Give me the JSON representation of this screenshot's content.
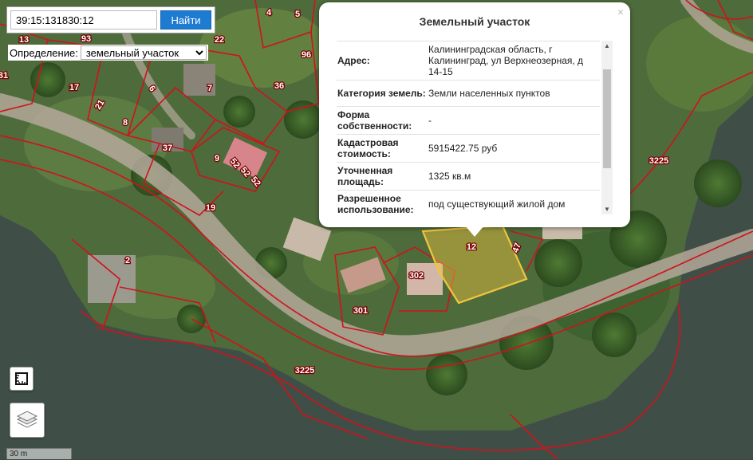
{
  "search": {
    "value": "39:15:131830:12",
    "button_label": "Найти"
  },
  "definition": {
    "label": "Определение:",
    "selected": "земельный участок"
  },
  "popup": {
    "title": "Земельный участок",
    "close_symbol": "×",
    "rows": [
      {
        "key": "Адрес:",
        "value": "Калининградская область, г Калининград, ул Верхнеозерная, д 14-15"
      },
      {
        "key": "Категория земель:",
        "value": "Земли населенных пунктов"
      },
      {
        "key": "Форма собственности:",
        "value": "-"
      },
      {
        "key": "Кадастровая стоимость:",
        "value": "5915422.75 руб"
      },
      {
        "key": "Уточненная площадь:",
        "value": "1325 кв.м"
      },
      {
        "key": "Разрешенное использование:",
        "value": "под существующий жилой дом"
      }
    ]
  },
  "map": {
    "parcel_numbers": [
      "13",
      "93",
      "31",
      "17",
      "21",
      "8",
      "6",
      "7",
      "4",
      "5",
      "22",
      "96",
      "36",
      "37",
      "9",
      "52",
      "52",
      "52",
      "19",
      "2",
      "302",
      "301",
      "12",
      "47",
      "3225",
      "3225"
    ],
    "selected_parcel": "12",
    "boundary_color": "#d0121b",
    "selected_color": "#f2c53d"
  },
  "controls": {
    "ruler_icon": "ruler-icon",
    "layers_icon": "layers-icon"
  },
  "scale": {
    "label": "30 m"
  }
}
